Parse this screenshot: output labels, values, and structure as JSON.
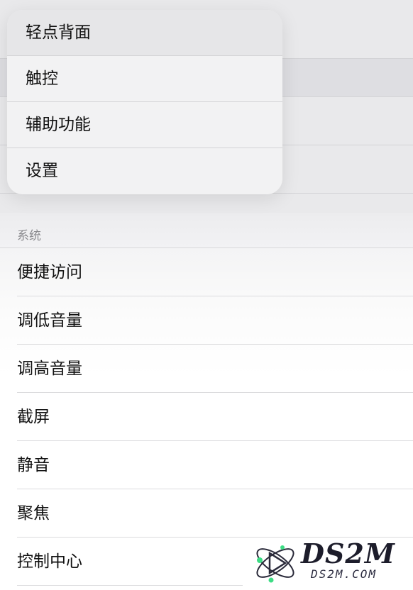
{
  "context_menu": {
    "items": [
      {
        "label": "轻点背面"
      },
      {
        "label": "触控"
      },
      {
        "label": "辅助功能"
      },
      {
        "label": "设置"
      }
    ]
  },
  "system_section": {
    "header": "系统",
    "items": [
      {
        "label": "便捷访问"
      },
      {
        "label": "调低音量"
      },
      {
        "label": "调高音量"
      },
      {
        "label": "截屏"
      },
      {
        "label": "静音"
      },
      {
        "label": "聚焦"
      },
      {
        "label": "控制中心"
      }
    ]
  },
  "watermark": {
    "logo_text": "DS2M",
    "domain_text": "DS2M.COM"
  }
}
